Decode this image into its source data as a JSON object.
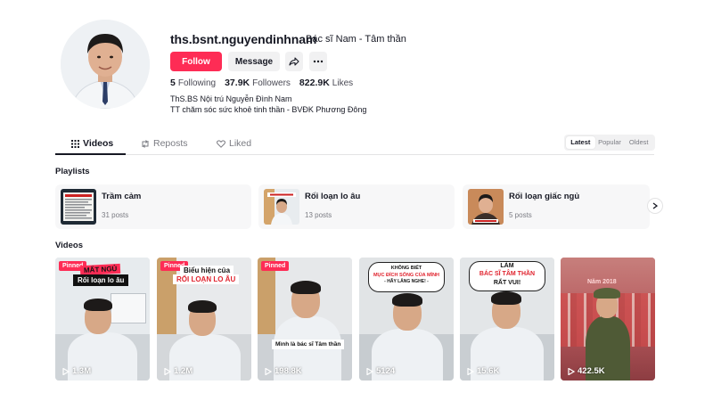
{
  "profile": {
    "username": "ths.bsnt.nguyendinhnam",
    "nickname": "Bác sĩ Nam - Tâm thần",
    "follow_label": "Follow",
    "message_label": "Message",
    "following_count": "5",
    "following_label": "Following",
    "followers_count": "37.9K",
    "followers_label": "Followers",
    "likes_count": "822.9K",
    "likes_label": "Likes",
    "bio_line1": "ThS.BS Nội trú Nguyễn Đình Nam",
    "bio_line2": "TT chăm sóc sức khoẻ tinh thần - BVĐK Phương Đông"
  },
  "tabs": [
    {
      "label": "Videos",
      "icon": "grid-icon"
    },
    {
      "label": "Reposts",
      "icon": "repost-icon"
    },
    {
      "label": "Liked",
      "icon": "heart-icon"
    }
  ],
  "sort": [
    "Latest",
    "Popular",
    "Oldest"
  ],
  "playlists_title": "Playlists",
  "playlists": [
    {
      "title": "Trầm cảm",
      "count": "31 posts"
    },
    {
      "title": "Rối loạn lo âu",
      "count": "13 posts"
    },
    {
      "title": "Rối loạn giấc ngủ",
      "count": "5 posts"
    }
  ],
  "videos_title": "Videos",
  "videos": [
    {
      "views": "1.3M",
      "pinned": "Pinned",
      "caption_a": "MẤT NGỦ",
      "caption_b": "Rối loạn lo âu"
    },
    {
      "views": "1.2M",
      "pinned": "Pinned",
      "caption_a": "Biểu hiện của",
      "caption_b": "RỐI LOẠN LO ÂU"
    },
    {
      "views": "198.8K",
      "pinned": "Pinned",
      "caption_a": "Mình là bác sĩ Tâm thần"
    },
    {
      "views": "5124",
      "caption_a": "KHÔNG BIẾT",
      "caption_b": "MỤC ĐÍCH SỐNG CỦA MÌNH",
      "caption_c": "- HÃY LẮNG NGHE! -"
    },
    {
      "views": "15.6K",
      "caption_a": "LÀM",
      "caption_b": "BÁC SĨ TÂM THẦN",
      "caption_c": "RẤT VUI!"
    },
    {
      "views": "422.5K",
      "caption_a": "Năm 2018"
    }
  ],
  "colors": {
    "accent": "#fe2c55",
    "text": "#161823",
    "muted": "#7a7b82"
  }
}
